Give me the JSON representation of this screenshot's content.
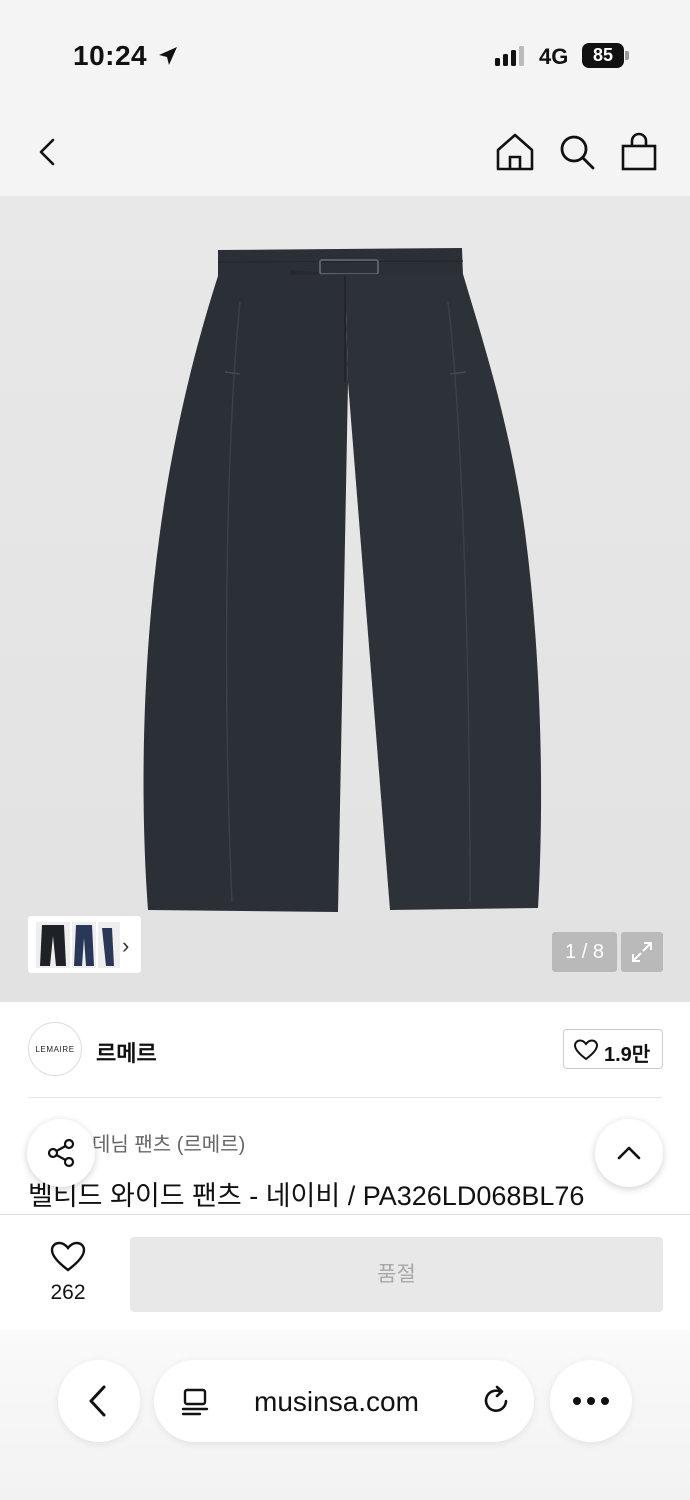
{
  "status_bar": {
    "time": "10:24",
    "network": "4G",
    "battery": "85"
  },
  "header": {
    "icons": [
      "back-icon",
      "home-icon",
      "search-icon",
      "shopping-bag-icon"
    ]
  },
  "gallery": {
    "page_counter": "1 / 8",
    "thumbnail_next": "›"
  },
  "brand": {
    "logo_text": "LEMAIRE",
    "name": "르메르",
    "likes": "1.9만"
  },
  "product": {
    "category": "데님 팬츠 (르메르)",
    "title": "벨티드 와이드 팬츠 - 네이비 / PA326LD068BL76"
  },
  "buy_bar": {
    "wish_count": "262",
    "button_label": "품절"
  },
  "browser": {
    "url": "musinsa.com"
  },
  "colors": {
    "denim": "#2b2f36",
    "soldout_bg": "#e8e8e8",
    "soldout_text": "#a8a8a8"
  }
}
